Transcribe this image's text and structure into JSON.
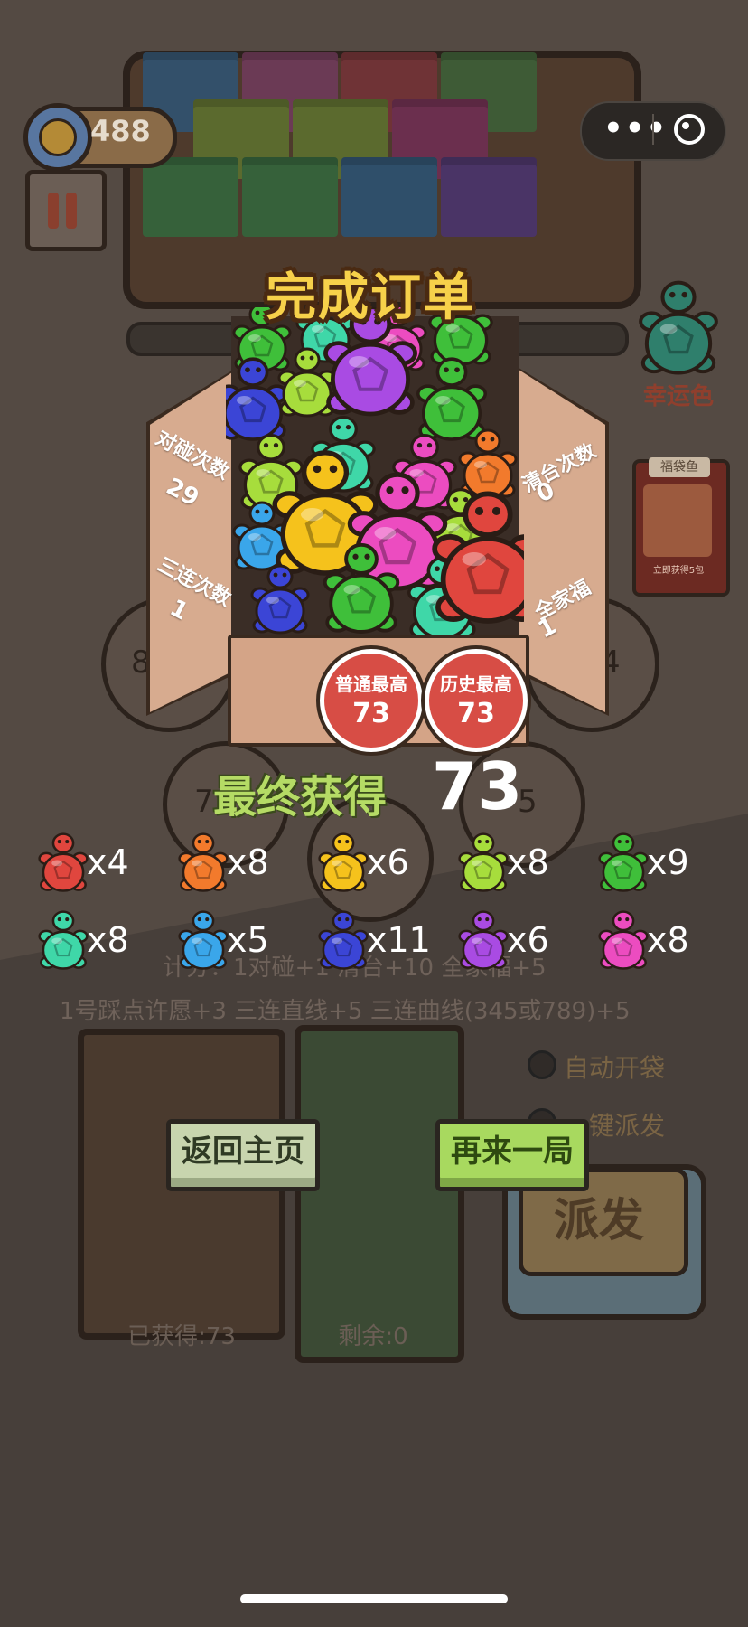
{
  "hud": {
    "coins": "488",
    "lucky_color_label": "幸运色",
    "gift_card": {
      "title": "福袋鱼",
      "footer": "立即获得5包"
    }
  },
  "board": {
    "slots": [
      "8",
      "7",
      "5",
      "4"
    ],
    "rules_line_1": "计分：1对碰+1 清台+10 全家福+5",
    "rules_line_2": "1号踩点许愿+3 三连直线+5 三连曲线(345或789)+5"
  },
  "bins": {
    "obtained_label": "已获得:73",
    "remaining_label": "剩余:0"
  },
  "options": {
    "auto_open": "自动开袋",
    "one_click_dispatch": "一键派发",
    "dispatch_button": "派发"
  },
  "result": {
    "title": "完成订单",
    "stats": {
      "pair_label": "对碰次数",
      "pair_value": "29",
      "clear_label": "清台次数",
      "clear_value": "0",
      "triple_label": "三连次数",
      "triple_value": "1",
      "family_label": "全家福",
      "family_value": "1"
    },
    "badges": [
      {
        "label": "普通最高",
        "value": "73"
      },
      {
        "label": "历史最高",
        "value": "73"
      }
    ],
    "final_label": "最终获得",
    "final_value": "73",
    "tally": [
      {
        "color": "#e0463e",
        "count": "x4"
      },
      {
        "color": "#f27a2c",
        "count": "x8"
      },
      {
        "color": "#f5c21c",
        "count": "x6"
      },
      {
        "color": "#a7dd3c",
        "count": "x8"
      },
      {
        "color": "#3fbf3a",
        "count": "x9"
      },
      {
        "color": "#3fd7a8",
        "count": "x8"
      },
      {
        "color": "#3aa6ea",
        "count": "x5"
      },
      {
        "color": "#3b45d6",
        "count": "x11"
      },
      {
        "color": "#a94be3",
        "count": "x6"
      },
      {
        "color": "#ec4cc0",
        "count": "x8"
      }
    ],
    "buttons": {
      "home": "返回主页",
      "again": "再来一局"
    }
  },
  "colors": {
    "lucky_turtle": "#2f7f6c",
    "box_turtles": [
      "#3fbf3a",
      "#a7dd3c",
      "#a94be3",
      "#3b45d6",
      "#ec4cc0",
      "#f5c21c",
      "#e0463e",
      "#3fd7a8",
      "#f27a2c",
      "#3aa6ea"
    ]
  }
}
